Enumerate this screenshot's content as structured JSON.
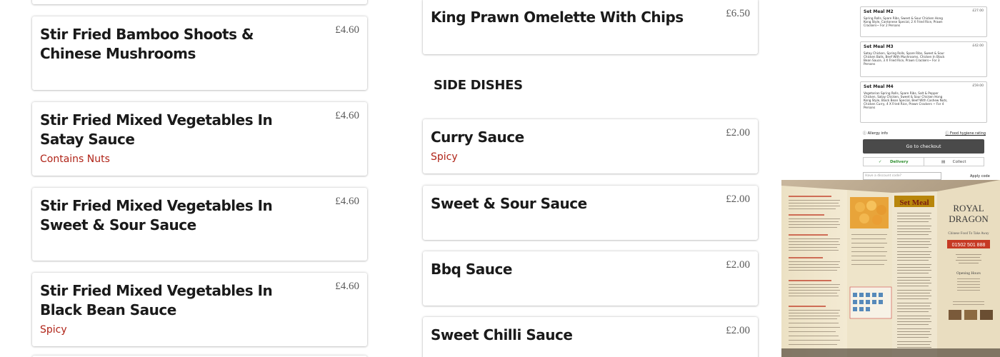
{
  "left_items": [
    {
      "name": "",
      "price": "",
      "note": ""
    },
    {
      "name": "Stir Fried Bamboo Shoots & Chinese Mushrooms",
      "price": "£4.60",
      "note": ""
    },
    {
      "name": "Stir Fried Mixed Vegetables In Satay Sauce",
      "price": "£4.60",
      "note": "Contains Nuts"
    },
    {
      "name": "Stir Fried Mixed Vegetables In Sweet & Sour Sauce",
      "price": "£4.60",
      "note": ""
    },
    {
      "name": "Stir Fried Mixed Vegetables In Black Bean Sauce",
      "price": "£4.60",
      "note": "Spicy"
    }
  ],
  "top_item": {
    "name": "King Prawn Omelette With Chips",
    "price": "£6.50"
  },
  "section": {
    "title": "SIDE DISHES"
  },
  "side_dishes": [
    {
      "name": "Curry Sauce",
      "price": "£2.00",
      "note": "Spicy"
    },
    {
      "name": "Sweet & Sour Sauce",
      "price": "£2.00",
      "note": ""
    },
    {
      "name": "Bbq Sauce",
      "price": "£2.00",
      "note": ""
    },
    {
      "name": "Sweet Chilli Sauce",
      "price": "£2.00",
      "note": ""
    }
  ],
  "cart_preview": {
    "set_meals": [
      {
        "name": "Set Meal M2",
        "price": "£27.00",
        "desc": "Spring Rolls, Spare Ribs, Sweet & Sour Chicken Hong Kong Style, Cantonese Special, 2 X Fried Rice, Prawn Crackers~ For 2 Persons"
      },
      {
        "name": "Set Meal M3",
        "price": "£42.00",
        "desc": "Satay Chicken, Spring Rolls, Spare Ribs, Sweet & Sour Chicken Balls, Beef With Mushrooms, Chicken In Black Bean Sauce, 3 X Fried Rice, Prawn Crackers~ For 3 Persons"
      },
      {
        "name": "Set Meal M4",
        "price": "£59.00",
        "desc": "Vegetarian Spring Rolls, Spare Ribs, Salt & Pepper Chicken, Satay Chicken, Sweet & Sour Chicken Hong Kong Style, Black Bean Special, Beef With Cashew Nuts, Chicken Curry, 4 X Fried Rice, Prawn Crackers ~ For 4 Persons"
      }
    ],
    "allergy_link": "Allergy info",
    "hygiene_link": "Food hygiene rating",
    "checkout_label": "Go to checkout",
    "delivery_label": "Delivery",
    "collect_label": "Collect",
    "discount_placeholder": "Have a discount code?",
    "apply_label": "Apply code"
  },
  "menu_photo": {
    "panel_title": "Set Meal",
    "brand": "ROYAL DRAGON",
    "tagline": "Chinese Food To Take Away",
    "phone": "01502 501 888",
    "hours_title": "Opening Hours"
  },
  "colors": {
    "note_red": "#b02418",
    "price_grey": "#5a5a5a",
    "checkout_bg": "#4a4a4a",
    "delivery_green": "#2f8f2f"
  }
}
